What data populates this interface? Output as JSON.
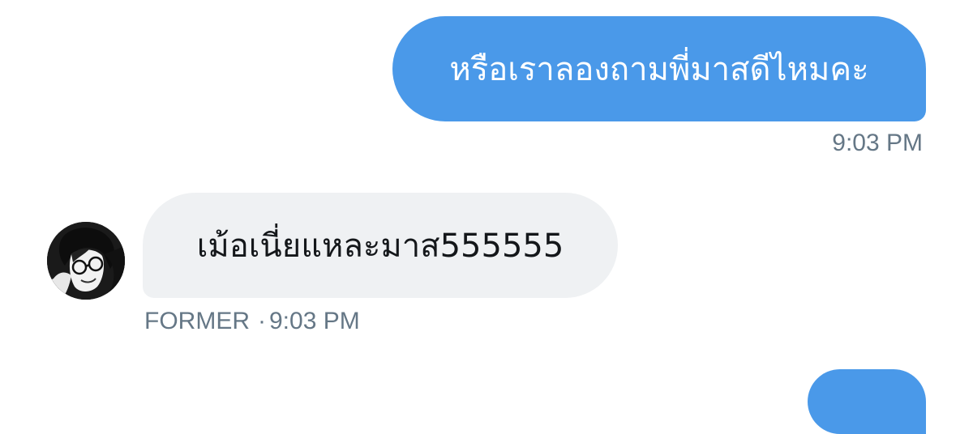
{
  "conversation": {
    "messages": [
      {
        "direction": "outgoing",
        "text": "หรือเราลองถามพี่มาสดีไหมคะ",
        "time": "9:03 PM"
      },
      {
        "direction": "incoming",
        "sender": "FORMER",
        "separator": "·",
        "text": "เม้อเนี่ยแหละมาส555555",
        "time": "9:03 PM",
        "avatar_icon": "user-avatar"
      }
    ]
  },
  "colors": {
    "outgoing_bubble": "#4a99e9",
    "incoming_bubble": "#eff1f3",
    "meta_text": "#657786",
    "message_text_dark": "#14171a"
  }
}
